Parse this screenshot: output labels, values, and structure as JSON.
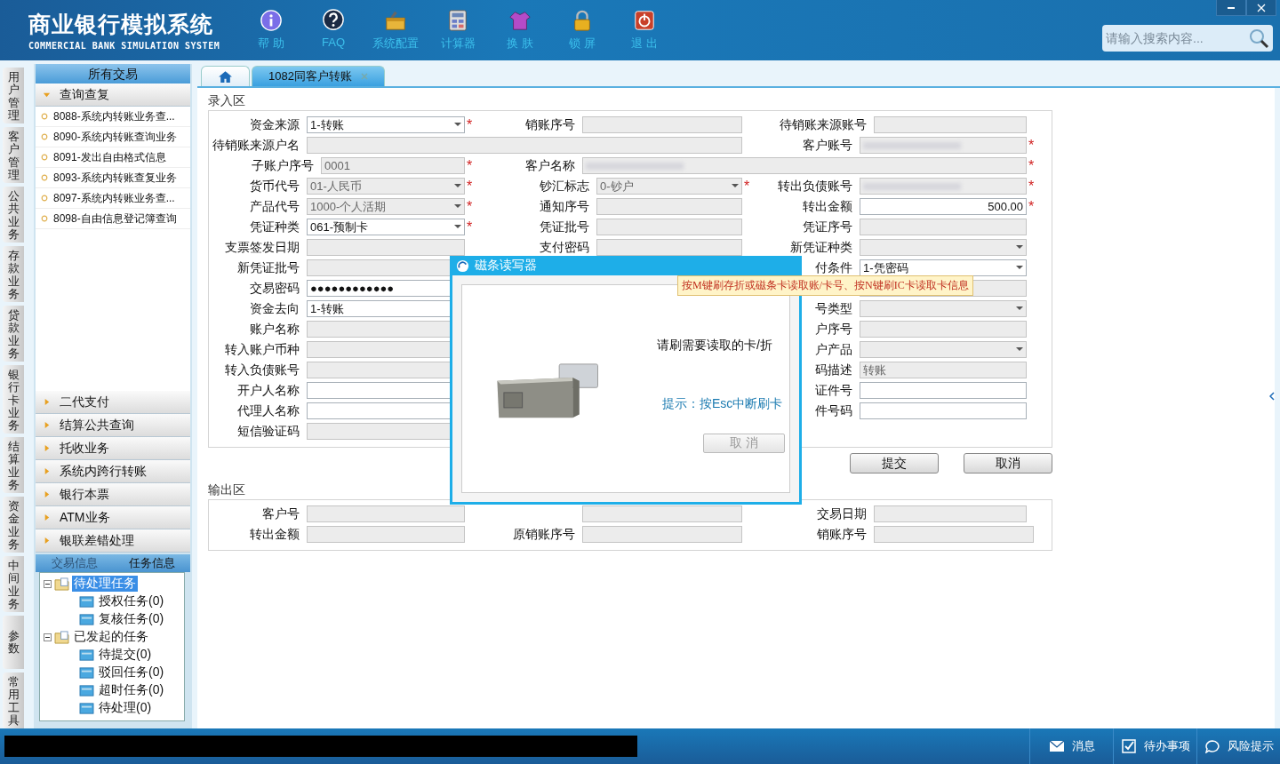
{
  "app": {
    "title": "商业银行模拟系统",
    "subtitle": "COMMERCIAL BANK SIMULATION SYSTEM"
  },
  "toolbar": [
    {
      "label": "帮 助",
      "kind": "info"
    },
    {
      "label": "FAQ",
      "kind": "faq"
    },
    {
      "label": "系统配置",
      "kind": "config"
    },
    {
      "label": "计算器",
      "kind": "calc"
    },
    {
      "label": "换 肤",
      "kind": "skin"
    },
    {
      "label": "锁 屏",
      "kind": "lock"
    },
    {
      "label": "退 出",
      "kind": "exit"
    }
  ],
  "search": {
    "placeholder": "请输入搜索内容..."
  },
  "side_tabs": [
    "用户管理",
    "客户管理",
    "公共业务",
    "存款业务",
    "贷款业务",
    "银行卡业务",
    "结算业务",
    "资金业务",
    "中间业务",
    "参数",
    "常用工具"
  ],
  "sidebar": {
    "title": "所有交易",
    "groups": [
      {
        "label": "查询查复",
        "expanded": true,
        "items": [
          "8088-系统内转账业务查...",
          "8090-系统内转账查询业务",
          "8091-发出自由格式信息",
          "8093-系统内转账查复业务",
          "8097-系统内转账业务查...",
          "8098-自由信息登记簿查询"
        ]
      },
      {
        "label": "二代支付",
        "expanded": false
      },
      {
        "label": "结算公共查询",
        "expanded": false
      },
      {
        "label": "托收业务",
        "expanded": false
      },
      {
        "label": "系统内跨行转账",
        "expanded": false
      },
      {
        "label": "银行本票",
        "expanded": false
      },
      {
        "label": "ATM业务",
        "expanded": false
      },
      {
        "label": "银联差错处理",
        "expanded": false
      }
    ],
    "bottom_tabs": [
      {
        "label": "交易信息",
        "selected": false
      },
      {
        "label": "任务信息",
        "selected": true
      }
    ],
    "tree": [
      {
        "label": "待处理任务",
        "selected": true,
        "expanded": true,
        "children": [
          {
            "label": "授权任务(0)",
            "selected": false
          },
          {
            "label": "复核任务(0)",
            "selected": false
          }
        ]
      },
      {
        "label": "已发起的任务",
        "selected": false,
        "expanded": true,
        "children": [
          {
            "label": "待提交(0)",
            "selected": false
          },
          {
            "label": "驳回任务(0)",
            "selected": false
          },
          {
            "label": "超时任务(0)",
            "selected": false
          },
          {
            "label": "待处理(0)",
            "selected": false
          }
        ]
      }
    ]
  },
  "tabs": [
    {
      "kind": "home",
      "selected": false
    },
    {
      "kind": "page",
      "label": "1082同客户转账",
      "selected": true
    }
  ],
  "input_section": {
    "title": "录入区",
    "rows": [
      {
        "left": {
          "label": "资金来源",
          "kind": "select",
          "value": "1-转账",
          "disabled": false,
          "mark": "*"
        },
        "middle": {
          "label": "销账序号",
          "kind": "input",
          "disabled": true
        },
        "right": {
          "label": "待销账来源账号",
          "kind": "input",
          "disabled": true
        }
      },
      {
        "left": {
          "label": "待销账来源户名",
          "kind": "input",
          "disabled": true,
          "wide": true
        },
        "right": {
          "label": "客户账号",
          "kind": "input",
          "disabled": true,
          "blurred": true,
          "mark": "*"
        }
      },
      {
        "left": {
          "label": "子账户序号",
          "kind": "input",
          "value": "0001",
          "disabled": true,
          "mark": "*"
        },
        "middle": {
          "label": "客户名称",
          "kind": "input",
          "disabled": true,
          "blurred": true,
          "wide": true,
          "mark": "*"
        }
      },
      {
        "left": {
          "label": "货币代号",
          "kind": "select",
          "value": "01-人民币",
          "disabled": true,
          "mark": "*"
        },
        "middle": {
          "label": "钞汇标志",
          "kind": "select",
          "value": "0-钞户",
          "disabled": true,
          "mark": "*"
        },
        "right": {
          "label": "转出负债账号",
          "kind": "input",
          "disabled": true,
          "blurred": true,
          "mark": "*"
        }
      },
      {
        "left": {
          "label": "产品代号",
          "kind": "select",
          "value": "1000-个人活期",
          "disabled": true,
          "mark": "*"
        },
        "middle": {
          "label": "通知序号",
          "kind": "input",
          "disabled": true
        },
        "right": {
          "label": "转出金额",
          "kind": "amount",
          "value": "500.00",
          "disabled": false,
          "mark": "*"
        }
      },
      {
        "left": {
          "label": "凭证种类",
          "kind": "select",
          "value": "061-预制卡",
          "disabled": false,
          "mark": "*"
        },
        "middle": {
          "label": "凭证批号",
          "kind": "input",
          "disabled": true
        },
        "right": {
          "label": "凭证序号",
          "kind": "input",
          "disabled": true
        }
      },
      {
        "left": {
          "label": "支票签发日期",
          "kind": "input",
          "disabled": true
        },
        "middle": {
          "label": "支付密码",
          "kind": "input",
          "disabled": true
        },
        "right": {
          "label": "新凭证种类",
          "kind": "select",
          "disabled": true
        }
      },
      {
        "left": {
          "label": "新凭证批号",
          "kind": "input",
          "disabled": true
        },
        "right": {
          "label": "付条件",
          "kind": "select",
          "value": "1-凭密码",
          "disabled": false
        }
      },
      {
        "left": {
          "label": "交易密码",
          "kind": "password",
          "value": "●●●●●●●●●●●●",
          "disabled": false
        },
        "right": {
          "kind": "input",
          "disabled": true
        }
      },
      {
        "left": {
          "label": "资金去向",
          "kind": "input",
          "value": "1-转账",
          "disabled": false
        },
        "right": {
          "label": "号类型",
          "kind": "select",
          "disabled": true
        }
      },
      {
        "left": {
          "label": "账户名称",
          "kind": "input",
          "disabled": true
        },
        "right": {
          "label": "户序号",
          "kind": "input",
          "disabled": true
        }
      },
      {
        "left": {
          "label": "转入账户币种",
          "kind": "input",
          "disabled": true
        },
        "right": {
          "label": "户产品",
          "kind": "select",
          "disabled": true
        }
      },
      {
        "left": {
          "label": "转入负债账号",
          "kind": "input",
          "disabled": true
        },
        "right": {
          "label": "码描述",
          "kind": "input",
          "value": "转账",
          "disabled": true
        }
      },
      {
        "left": {
          "label": "开户人名称",
          "kind": "input",
          "disabled": false
        },
        "right": {
          "label": "证件号",
          "kind": "input",
          "disabled": false
        }
      },
      {
        "left": {
          "label": "代理人名称",
          "kind": "input",
          "disabled": false
        },
        "right": {
          "label": "件号码",
          "kind": "input",
          "disabled": false
        }
      },
      {
        "left": {
          "label": "短信验证码",
          "kind": "input",
          "disabled": true
        }
      }
    ]
  },
  "actions": [
    "提交",
    "取消"
  ],
  "output_section": {
    "title": "输出区",
    "rows": [
      {
        "left": {
          "label": "客户号",
          "disabled": true
        },
        "middle": {
          "disabled": true
        },
        "right": {
          "label": "交易日期",
          "disabled": true
        }
      },
      {
        "left": {
          "label": "转出金额",
          "disabled": true
        },
        "middle": {
          "label": "原销账序号",
          "disabled": true
        },
        "right": {
          "label": "销账序号",
          "disabled": true
        }
      }
    ]
  },
  "dialog": {
    "title": "磁条读写器",
    "tooltip": "按M键刷存折或磁条卡读取账/卡号、按N键刷IC卡读取卡信息",
    "message": "请刷需要读取的卡/折",
    "hint": "提示：按Esc中断刷卡",
    "cancel": {
      "label": "取 消",
      "disabled": true
    }
  },
  "status_bar": [
    {
      "label": "消息",
      "kind": "mail"
    },
    {
      "label": "待办事项",
      "kind": "check"
    },
    {
      "label": "风险提示",
      "kind": "chat"
    }
  ]
}
